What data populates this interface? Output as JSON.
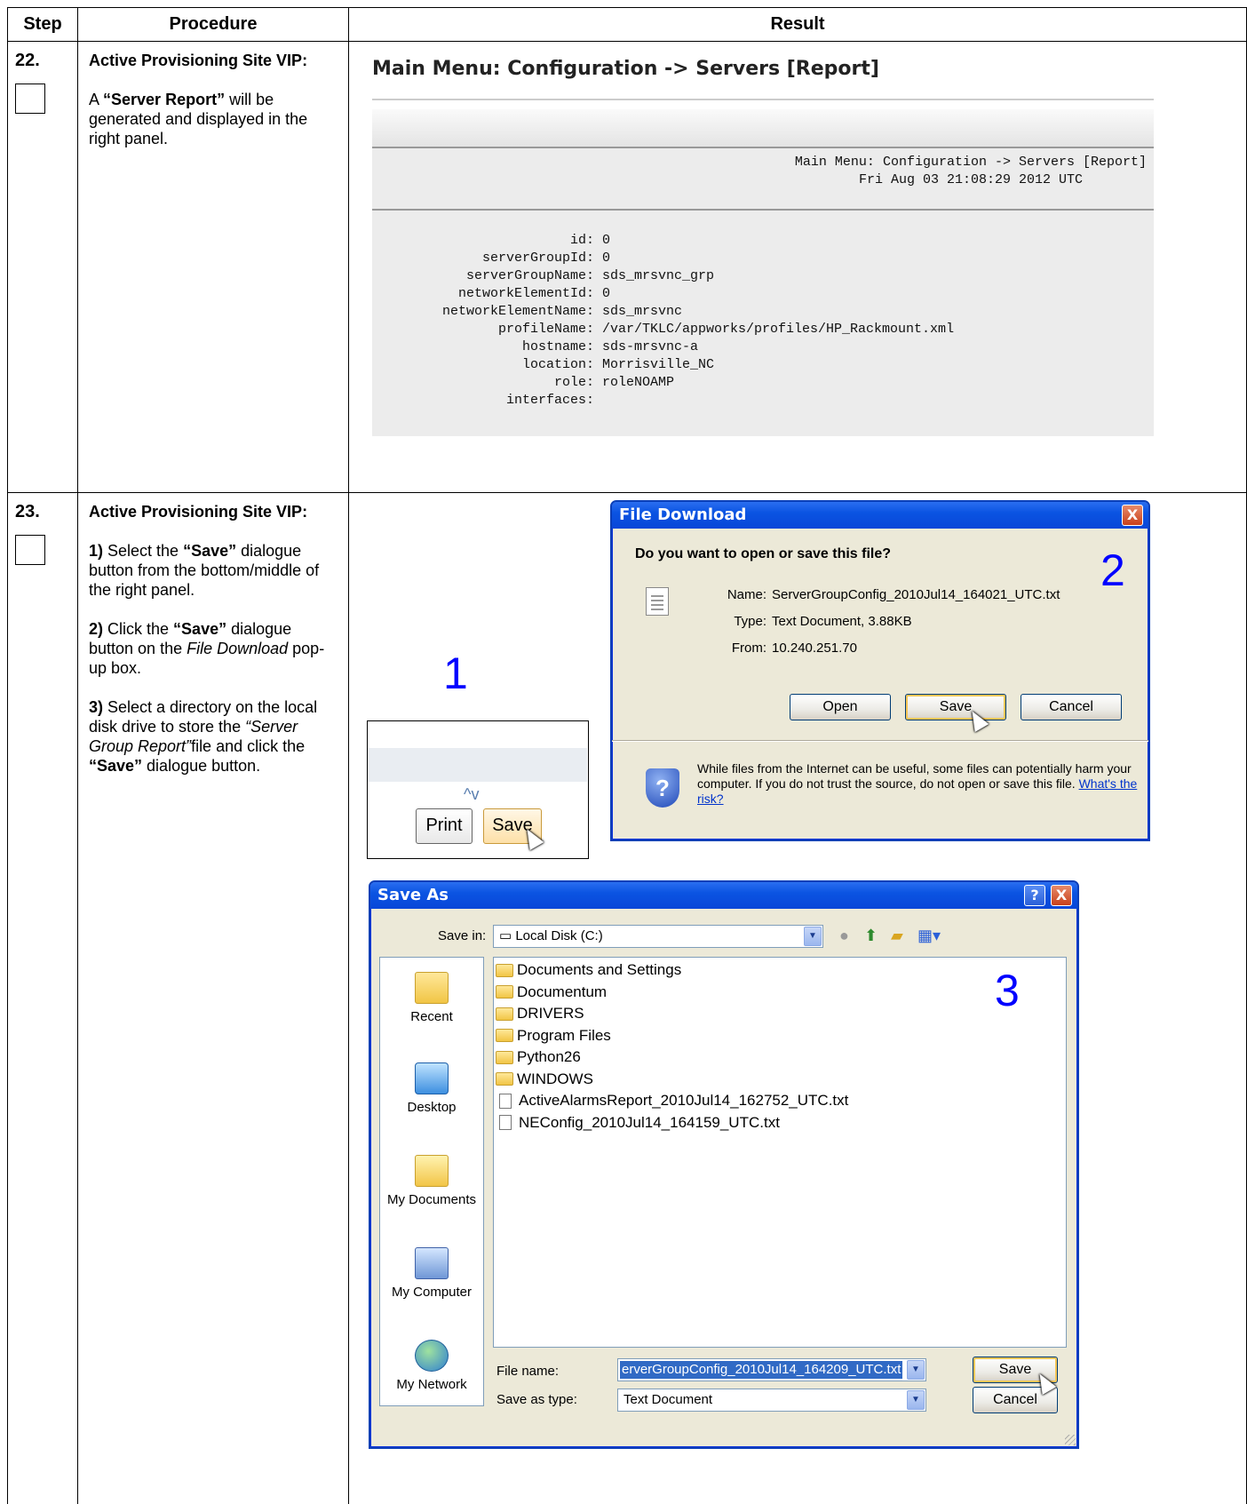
{
  "table": {
    "headers": {
      "step": "Step",
      "procedure": "Procedure",
      "result": "Result"
    }
  },
  "step22": {
    "number": "22.",
    "title": "Active Provisioning Site VIP:",
    "text_a": "A ",
    "text_b": "“Server Report”",
    "text_c": " will be generated and displayed in the right panel.",
    "report": {
      "title": "Main Menu: Configuration -> Servers [Report]",
      "header_line1": "Main Menu: Configuration -> Servers [Report]",
      "header_line2": "Fri Aug 03 21:08:29 2012 UTC",
      "fields": [
        {
          "key": "id:",
          "value": "0"
        },
        {
          "key": "serverGroupId:",
          "value": "0"
        },
        {
          "key": "serverGroupName:",
          "value": "sds_mrsvnc_grp"
        },
        {
          "key": "networkElementId:",
          "value": "0"
        },
        {
          "key": "networkElementName:",
          "value": "sds_mrsvnc"
        },
        {
          "key": "profileName:",
          "value": "/var/TKLC/appworks/profiles/HP_Rackmount.xml"
        },
        {
          "key": "hostname:",
          "value": "sds-mrsvnc-a"
        },
        {
          "key": "location:",
          "value": "Morrisville_NC"
        },
        {
          "key": "role:",
          "value": "roleNOAMP"
        },
        {
          "key": "interfaces:",
          "value": ""
        }
      ]
    }
  },
  "step23": {
    "number": "23.",
    "title": "Active Provisioning Site VIP:",
    "s1_num": "1)",
    "s1_a": " Select the ",
    "s1_b": "“Save”",
    "s1_c": " dialogue button from the bottom/middle of the right panel.",
    "s2_num": "2)",
    "s2_a": " Click the ",
    "s2_b": "“Save”",
    "s2_c": " dialogue button on the ",
    "s2_d": "File Download",
    "s2_e": " pop-up box.",
    "s3_num": "3)",
    "s3_a": " Select a directory on the local disk drive to store the ",
    "s3_b": "“Server Group Report”",
    "s3_c": "file and click the ",
    "s3_d": "“Save”",
    "s3_e": " dialogue button.",
    "callouts": {
      "one": "1",
      "two": "2",
      "three": "3"
    },
    "snippet": {
      "chevron": "^v",
      "print": "Print",
      "save": "Save"
    },
    "file_download": {
      "title": "File Download",
      "question": "Do you want to open or save this file?",
      "name_label": "Name:",
      "name_value": "ServerGroupConfig_2010Jul14_164021_UTC.txt",
      "type_label": "Type:",
      "type_value": "Text Document, 3.88KB",
      "from_label": "From:",
      "from_value": "10.240.251.70",
      "buttons": {
        "open": "Open",
        "save": "Save",
        "cancel": "Cancel"
      },
      "warning": "While files from the Internet can be useful, some files can potentially harm your computer. If you do not trust the source, do not open or save this file. ",
      "risk_link": "What's the risk?",
      "close": "X"
    },
    "save_as": {
      "title": "Save As",
      "help": "?",
      "close": "X",
      "save_in_label": "Save in:",
      "save_in_value": "Local Disk (C:)",
      "places": [
        "Recent",
        "Desktop",
        "My Documents",
        "My Computer",
        "My Network"
      ],
      "files": [
        {
          "name": "Documents and Settings",
          "kind": "folder"
        },
        {
          "name": "Documentum",
          "kind": "folder"
        },
        {
          "name": "DRIVERS",
          "kind": "folder"
        },
        {
          "name": "Program Files",
          "kind": "folder"
        },
        {
          "name": "Python26",
          "kind": "folder"
        },
        {
          "name": "WINDOWS",
          "kind": "folder"
        },
        {
          "name": "ActiveAlarmsReport_2010Jul14_162752_UTC.txt",
          "kind": "txt"
        },
        {
          "name": "NEConfig_2010Jul14_164159_UTC.txt",
          "kind": "txt"
        }
      ],
      "file_name_label": "File name:",
      "file_name_value": "erverGroupConfig_2010Jul14_164209_UTC.txt",
      "save_type_label": "Save as type:",
      "save_type_value": "Text Document",
      "save_button": "Save",
      "cancel_button": "Cancel"
    }
  }
}
